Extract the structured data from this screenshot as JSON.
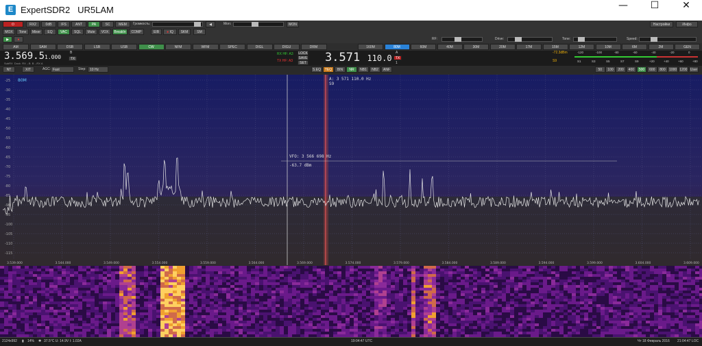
{
  "window": {
    "app_name": "ExpertSDR2",
    "callsign": "UR5LAM",
    "minimize": "—",
    "maximize": "☐",
    "close": "✕"
  },
  "toolbar1": {
    "power": "⏻",
    "rx2": "RX2",
    "db": "0dB",
    "ifs": "IFS",
    "ant": "ANT",
    "pa": "PA",
    "sc": "SC",
    "mem": "MEM",
    "volume_label": "Громкость:",
    "mon_label": "Mon:",
    "mon_btn": "MON",
    "settings": "Настройки",
    "info": "Инфо"
  },
  "toolbar2": {
    "buttons": [
      "MOX",
      "Tone",
      "Mixer",
      "EQ",
      "VAC",
      "SQL",
      "Mute",
      "VOX",
      "BreakIn",
      "COMP",
      "EIB",
      "",
      "IQ",
      "SKM",
      "SM"
    ],
    "rf_label": "RF:",
    "drive_label": "Drive:",
    "tone_label": "Tone:",
    "speed_label": "Speed:"
  },
  "modes": [
    "AM",
    "SAM",
    "DSB",
    "LSB",
    "USB",
    "CW",
    "NFM",
    "WFM",
    "SPEC",
    "DIGL",
    "DIGU",
    "DRM"
  ],
  "active_mode": "CW",
  "bands": [
    "160M",
    "80M",
    "60M",
    "40M",
    "30M",
    "20M",
    "17M",
    "15M",
    "12M",
    "10M",
    "6M",
    "2M",
    "GEN"
  ],
  "active_band": "80M",
  "vfo": {
    "b_freq_main": "3.569.5",
    "b_freq_sub": "1.000",
    "b_label": "B",
    "b_tx": "TX",
    "mini_buttons": [
      "SubRX",
      "Dock",
      "RX→B",
      "B→RX A"
    ],
    "rx_hf": "RX HF: A3",
    "tx_hf": "TX HF: A3",
    "lock": "LOCK",
    "save": "SAVE",
    "set": "SET",
    "a_freq_main": "3.571",
    "a_freq_sub": "110.0",
    "a_label": "A",
    "a_tx": "TX",
    "a_sub": "1"
  },
  "smeter": {
    "value": "-72.3dBm",
    "s_reading": "S9",
    "top_scale": [
      "-120",
      "-100",
      "-80",
      "-60",
      "-40",
      "-20",
      "0"
    ],
    "bottom_scale": [
      "S1",
      "S3",
      "S5",
      "S7",
      "S9",
      "+20",
      "+40",
      "+60",
      "+80"
    ]
  },
  "controls": {
    "nt": "NT",
    "xit": "XIT",
    "agc_label": "AGC:",
    "agc_value": "Fast",
    "step_label": "Step:",
    "step_value": "10 Hz",
    "dsp": [
      "S.EQ",
      "TEQ",
      "BIN",
      "NR",
      "NB1",
      "NB2",
      "ANF"
    ],
    "filters": [
      "50",
      "100",
      "200",
      "400",
      "500",
      "600",
      "800",
      "1000",
      "1200",
      "User"
    ],
    "active_filter": "500"
  },
  "spectrum": {
    "band_label": "80M",
    "db_labels": [
      "-25",
      "-30",
      "-35",
      "-40",
      "-45",
      "-50",
      "-55",
      "-60",
      "-65",
      "-70",
      "-75",
      "-80",
      "-85",
      "-90",
      "-95",
      "-100",
      "-105",
      "-110",
      "-115"
    ],
    "cursor_freq": "A: 3 571 110.0 Hz",
    "cursor_s": "S9",
    "vfo_readout": "VFO: 3 566 698 Hz",
    "vfo_dbm": "-63.7 dBm",
    "freq_ticks": [
      "3.539.000",
      "3.544.000",
      "3.549.000",
      "3.554.000",
      "3.559.000",
      "3.564.000",
      "3.569.000",
      "3.574.000",
      "3.579.000",
      "3.584.000",
      "3.589.000",
      "3.594.000",
      "3.599.000",
      "3.604.000",
      "3.609.000"
    ]
  },
  "status": {
    "resolution": "2124x992",
    "cpu": "14%",
    "temp": "37.5°C U: 14.9V I: 1.02A",
    "utc": "19:04:47 UTC",
    "date": "Чт 18 Февраль 2016",
    "loc": "21:04:47 LOC"
  },
  "colors": {
    "active_green": "#3f8f4a",
    "band_blue": "#2a82d8",
    "spectrum_top": "#1a1f6a",
    "spectrum_bottom": "#3a2230"
  }
}
